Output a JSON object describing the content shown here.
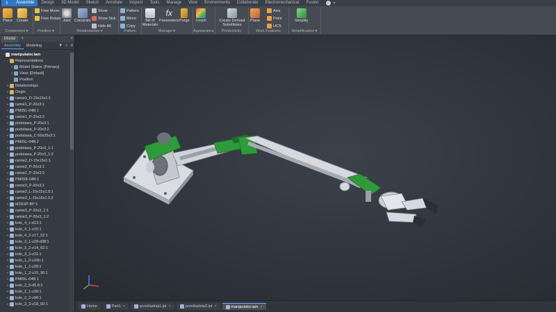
{
  "ribbon": {
    "tabs": [
      "Assemble",
      "Design",
      "3D Model",
      "Sketch",
      "Annotate",
      "Inspect",
      "Tools",
      "Manage",
      "View",
      "Environments",
      "Collaborate",
      "Electromechanical",
      "Fusion"
    ],
    "active_tab": "Assemble",
    "buttons": {
      "place": "Place",
      "create": "Create",
      "free_move": "Free Move",
      "free_rotate": "Free Rotate",
      "joint": "Joint",
      "constrain": "Constrain",
      "show": "Show",
      "show_sick": "Show Sick",
      "hide_all": "Hide All",
      "pattern": "Pattern",
      "mirror": "Mirror",
      "copy": "Copy",
      "bill_of_materials": "Bill of Materials",
      "parameters": "Parameters",
      "purge": "Purge",
      "finish": "Finish",
      "create_derived_substitutes": "Create Derived Substitutes",
      "plane": "Plane",
      "axis": "Axis",
      "point": "Point",
      "ucs": "UCS",
      "simplify": "Simplify"
    },
    "groups": {
      "component": "Component ▾",
      "position": "Position ▾",
      "relationships": "Relationships ▾",
      "pattern": "Pattern",
      "manage": "Manage ▾",
      "appearance": "Appearance",
      "productivity": "Productivity",
      "work_features": "Work Features",
      "simplification": "Simplification ▾"
    }
  },
  "browser": {
    "title": "Model",
    "subtabs": [
      "Assembly",
      "Modeling"
    ],
    "active_subtab": "Assembly",
    "tree": [
      {
        "label": "manipulator.iam",
        "level": 0,
        "type": "root",
        "expander": "−"
      },
      {
        "label": "Representations",
        "level": 1,
        "type": "folder",
        "expander": "−"
      },
      {
        "label": "Model States: [Primary]",
        "level": 2,
        "type": "node",
        "expander": "+"
      },
      {
        "label": "View: [Default]",
        "level": 2,
        "type": "node",
        "expander": "+"
      },
      {
        "label": "Position",
        "level": 2,
        "type": "node",
        "expander": ""
      },
      {
        "label": "Relationships",
        "level": 1,
        "type": "folder",
        "expander": "+"
      },
      {
        "label": "Origin",
        "level": 1,
        "type": "folder",
        "expander": "+"
      },
      {
        "label": "ramie1_D-15x15x1:1",
        "level": 1,
        "type": "part",
        "expander": "+"
      },
      {
        "label": "ramie1_P-20x3:1",
        "level": 1,
        "type": "part",
        "expander": "+"
      },
      {
        "label": "PM05L-04B:1",
        "level": 1,
        "type": "part",
        "expander": "+"
      },
      {
        "label": "ramie1_P-20x3:2",
        "level": 1,
        "type": "part",
        "expander": "+"
      },
      {
        "label": "podstawa_P-20x3:1",
        "level": 1,
        "type": "part",
        "expander": "+"
      },
      {
        "label": "podstawa_P-20x3:2",
        "level": 1,
        "type": "part",
        "expander": "+"
      },
      {
        "label": "podstawa_C-50x25x3:1",
        "level": 1,
        "type": "part",
        "expander": "+"
      },
      {
        "label": "PM05L-04B:2",
        "level": 1,
        "type": "part",
        "expander": "+"
      },
      {
        "label": "podstawa_P-20x3_1:1",
        "level": 1,
        "type": "part",
        "expander": "+"
      },
      {
        "label": "podstawa_P-20x3_1:2",
        "level": 1,
        "type": "part",
        "expander": "+"
      },
      {
        "label": "ramie2_D-15x15x1:1",
        "level": 1,
        "type": "part",
        "expander": "+"
      },
      {
        "label": "ramie2_P-20x3:1",
        "level": 1,
        "type": "part",
        "expander": "+"
      },
      {
        "label": "ramie2_P-20x3:2",
        "level": 1,
        "type": "part",
        "expander": "+"
      },
      {
        "label": "PM05B-04B:1",
        "level": 1,
        "type": "part",
        "expander": "+"
      },
      {
        "label": "ramie3_P-20x3:1",
        "level": 1,
        "type": "part",
        "expander": "+"
      },
      {
        "label": "ramie3_L-15x15x1.5:1",
        "level": 1,
        "type": "part",
        "expander": "+"
      },
      {
        "label": "ramie3_L-15x15x1.5:2",
        "level": 1,
        "type": "part",
        "expander": "+"
      },
      {
        "label": "M3SSP-BP:1",
        "level": 1,
        "type": "part",
        "expander": "+"
      },
      {
        "label": "ramie3_P-20x3_1:1",
        "level": 1,
        "type": "part",
        "expander": "+"
      },
      {
        "label": "ramie3_P-20x3_1:2",
        "level": 1,
        "type": "part",
        "expander": "+"
      },
      {
        "label": "kolo_4_z-d13:1",
        "level": 1,
        "type": "part",
        "expander": "+"
      },
      {
        "label": "kolo_4_1-z15:1",
        "level": 1,
        "type": "part",
        "expander": "+"
      },
      {
        "label": "kolo_4_2-z17_52:1",
        "level": 1,
        "type": "part",
        "expander": "+"
      },
      {
        "label": "kolo_3_1-z28-d38:1",
        "level": 1,
        "type": "part",
        "expander": "+"
      },
      {
        "label": "kolo_3_2-z14_62:1",
        "level": 1,
        "type": "part",
        "expander": "+"
      },
      {
        "label": "kolo_3_3-z31:1",
        "level": 1,
        "type": "part",
        "expander": "+"
      },
      {
        "label": "kolo_1_0-z16h:1",
        "level": 1,
        "type": "part",
        "expander": "+"
      },
      {
        "label": "kolo_1_1-z28:1",
        "level": 1,
        "type": "part",
        "expander": "+"
      },
      {
        "label": "kolo_1_2-z15_96:1",
        "level": 1,
        "type": "part",
        "expander": "+"
      },
      {
        "label": "PM05L-04B:1",
        "level": 1,
        "type": "part",
        "expander": "+"
      },
      {
        "label": "kolo_2_0-d5.8:1",
        "level": 1,
        "type": "part",
        "expander": "+"
      },
      {
        "label": "kolo_2_1-z30:1",
        "level": 1,
        "type": "part",
        "expander": "+"
      },
      {
        "label": "kolo_2_2-z96:1",
        "level": 1,
        "type": "part",
        "expander": "+"
      },
      {
        "label": "kolo_2_2-z18_60:1",
        "level": 1,
        "type": "part",
        "expander": "+"
      }
    ]
  },
  "doctabs": [
    {
      "label": "Home",
      "active": false,
      "closable": false
    },
    {
      "label": "Part1",
      "active": false,
      "closable": true
    },
    {
      "label": "przekladnia1.ipt",
      "active": false,
      "closable": true
    },
    {
      "label": "przekladnia2.ipt",
      "active": false,
      "closable": true
    },
    {
      "label": "manipulator.iam",
      "active": true,
      "closable": true
    }
  ],
  "colors": {
    "accent": "#2f78c4",
    "part_green": "#2f9a3a",
    "part_grey": "#c9cdd2"
  }
}
